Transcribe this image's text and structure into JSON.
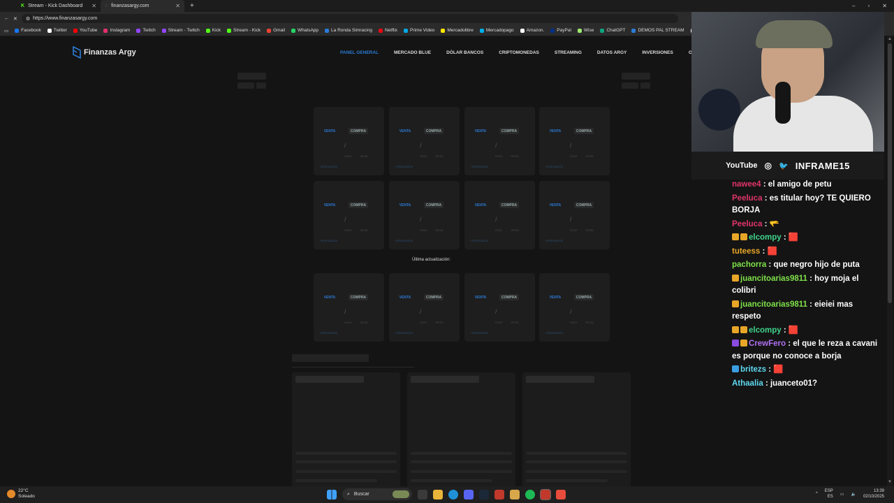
{
  "browser": {
    "tabs": [
      {
        "title": "Stream - Kick Dashboard",
        "active": false
      },
      {
        "title": "finanzasargy.com",
        "active": true
      }
    ],
    "url": "https://www.finanzasargy.com",
    "bookmarks": [
      "Facebook",
      "Twitter",
      "YouTube",
      "Instagram",
      "Twitch",
      "Stream - Twitch",
      "Kick",
      "Stream - Kick",
      "Gmail",
      "WhatsApp",
      "La Ronda Simracing",
      "Netflix",
      "Prime Video",
      "Mercadolibre",
      "Mercadopago",
      "Amazon.",
      "PayPal",
      "Wise",
      "ChatGPT",
      "DEMOS PAL STREAM",
      "JUAN TUR"
    ]
  },
  "site": {
    "brand": "Finanzas Argy",
    "nav": [
      "PANEL GENERAL",
      "MERCADO BLUE",
      "DÓLAR BANCOS",
      "CRIPTOMONEDAS",
      "STREAMING",
      "DATOS ARGY",
      "INVERSIONES",
      "OTRAS"
    ],
    "card": {
      "venta": "VENTA",
      "compra": "COMPRA",
      "slash": "/",
      "label_a": "Hace",
      "label_b": "Venta",
      "link": "+Información"
    },
    "last_update": "Última actualización:"
  },
  "overlay": {
    "social_youtube": "YouTube",
    "channel": "INFRAME15"
  },
  "chat": [
    {
      "user": "nawee4",
      "color": "#e0356a",
      "text": "el amigo de petu",
      "badges": []
    },
    {
      "user": "Peeluca",
      "color": "#e0356a",
      "text": "es titular hoy? TE QUIERO BORJA",
      "badges": []
    },
    {
      "user": "Peeluca",
      "color": "#e0356a",
      "text": "🫳",
      "badges": []
    },
    {
      "user": "elcompy",
      "color": "#3fd38a",
      "text": "🟥",
      "badges": [
        "#e8a628",
        "#e8a628"
      ]
    },
    {
      "user": "tuteess",
      "color": "#e8a628",
      "text": "🟥",
      "badges": []
    },
    {
      "user": "pachorra",
      "color": "#7ee04a",
      "text": "que negro hijo de puta",
      "badges": []
    },
    {
      "user": "juancitoarias9811",
      "color": "#7ee04a",
      "text": "hoy moja el colibri",
      "badges": [
        "#e8a628"
      ]
    },
    {
      "user": "juancitoarias9811",
      "color": "#7ee04a",
      "text": "eieiei mas respeto",
      "badges": [
        "#e8a628"
      ]
    },
    {
      "user": "elcompy",
      "color": "#3fd38a",
      "text": "🟥",
      "badges": [
        "#e8a628",
        "#e8a628"
      ]
    },
    {
      "user": "CrewFero",
      "color": "#b070f0",
      "text": "el que le reza a cavani es porque no conoce a borja",
      "badges": [
        "#8a4be0",
        "#e8a628"
      ]
    },
    {
      "user": "britezs",
      "color": "#5ed8f0",
      "text": "🟥",
      "badges": [
        "#3a9ee0"
      ]
    },
    {
      "user": "Athaalia",
      "color": "#5ed8f0",
      "text": "juanceto01?",
      "badges": []
    }
  ],
  "taskbar": {
    "temp": "22°C",
    "weather": "Soleado",
    "search": "Buscar",
    "lang1": "ESP",
    "lang2": "ES",
    "time": "13:39",
    "date": "02/10/2025"
  }
}
